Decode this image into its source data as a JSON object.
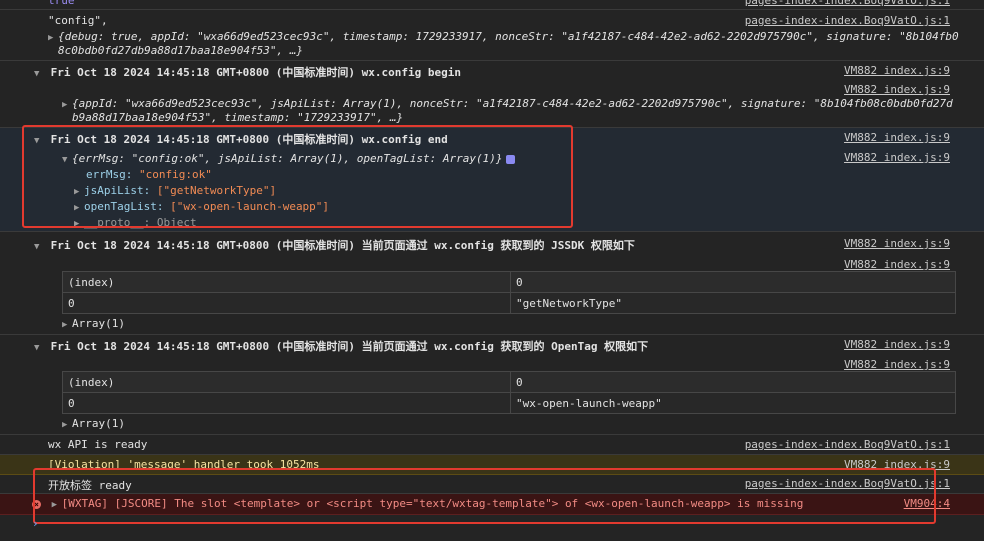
{
  "rows": {
    "r0": {
      "text": "true",
      "src": "pages-index-index.Boq9VatO.js:1"
    },
    "r1": {
      "label": "\"config\",",
      "src": "pages-index-index.Boq9VatO.js:1",
      "obj_line1": "{debug: true, appId: \"wxa66d9ed523cec93c\", timestamp: 1729233917, nonceStr: \"a1f42187-c484-42e2-ad62-2202d975790c\", signature: \"8b104fb0",
      "obj_line2": "8c0bdb0fd27db9a88d17baa18e904f53\", …}"
    },
    "r2": {
      "title": "Fri Oct 18 2024 14:45:18 GMT+0800 (中国标准时间) wx.config begin",
      "src": "VM882 index.js:9",
      "src2": "VM882 index.js:9",
      "obj_line1": "{appId: \"wxa66d9ed523cec93c\", jsApiList: Array(1), nonceStr: \"a1f42187-c484-42e2-ad62-2202d975790c\", signature: \"8b104fb08c0bdb0fd27d",
      "obj_line2": "b9a88d17baa18e904f53\", timestamp: \"1729233917\", …}"
    },
    "r3": {
      "title": "Fri Oct 18 2024 14:45:18 GMT+0800 (中国标准时间) wx.config end",
      "src": "VM882 index.js:9",
      "src2": "VM882 index.js:9",
      "summary": "{errMsg: \"config:ok\", jsApiList: Array(1), openTagList: Array(1)}",
      "errMsg_key": "errMsg:",
      "errMsg_val": "\"config:ok\"",
      "jsApiList_key": "jsApiList:",
      "jsApiList_val": "[\"getNetworkType\"]",
      "openTagList_key": "openTagList:",
      "openTagList_val": "[\"wx-open-launch-weapp\"]",
      "proto": "__proto__: Object"
    },
    "r4": {
      "title": "Fri Oct 18 2024 14:45:18 GMT+0800 (中国标准时间) 当前页面通过 wx.config 获取到的 JSSDK 权限如下",
      "src": "VM882 index.js:9",
      "src2": "VM882 index.js:9",
      "table": {
        "h0": "(index)",
        "h1": "0",
        "c0": "0",
        "c1": "\"getNetworkType\""
      },
      "array": "Array(1)"
    },
    "r5": {
      "title": "Fri Oct 18 2024 14:45:18 GMT+0800 (中国标准时间) 当前页面通过 wx.config 获取到的 OpenTag 权限如下",
      "src": "VM882 index.js:9",
      "src2": "VM882 index.js:9",
      "table": {
        "h0": "(index)",
        "h1": "0",
        "c0": "0",
        "c1": "\"wx-open-launch-weapp\""
      },
      "array": "Array(1)"
    },
    "r6": {
      "text": "wx API is ready",
      "src": "pages-index-index.Boq9VatO.js:1"
    },
    "r7": {
      "text": "[Violation] 'message' handler took 1052ms",
      "src": "VM882 index.js:9"
    },
    "r8": {
      "text": "开放标签 ready",
      "src": "pages-index-index.Boq9VatO.js:1"
    },
    "r9": {
      "text": "[WXTAG] [JSCORE] The slot <template> or <script type=\"text/wxtag-template\"> of <wx-open-launch-weapp> is missing",
      "src": "VM904:4"
    }
  },
  "colors": {
    "background": "#242424",
    "warning_bg": "#3a3417",
    "error_bg": "#3a1414",
    "error_text": "#f28b84",
    "highlight_box": "#e23a2f",
    "string": "#f28b54",
    "number": "#9a8cf2"
  },
  "icons": {
    "expand": "triangle-right-icon",
    "collapse": "triangle-down-icon",
    "error": "error-circle-icon",
    "prompt": "chevron-right-icon"
  }
}
